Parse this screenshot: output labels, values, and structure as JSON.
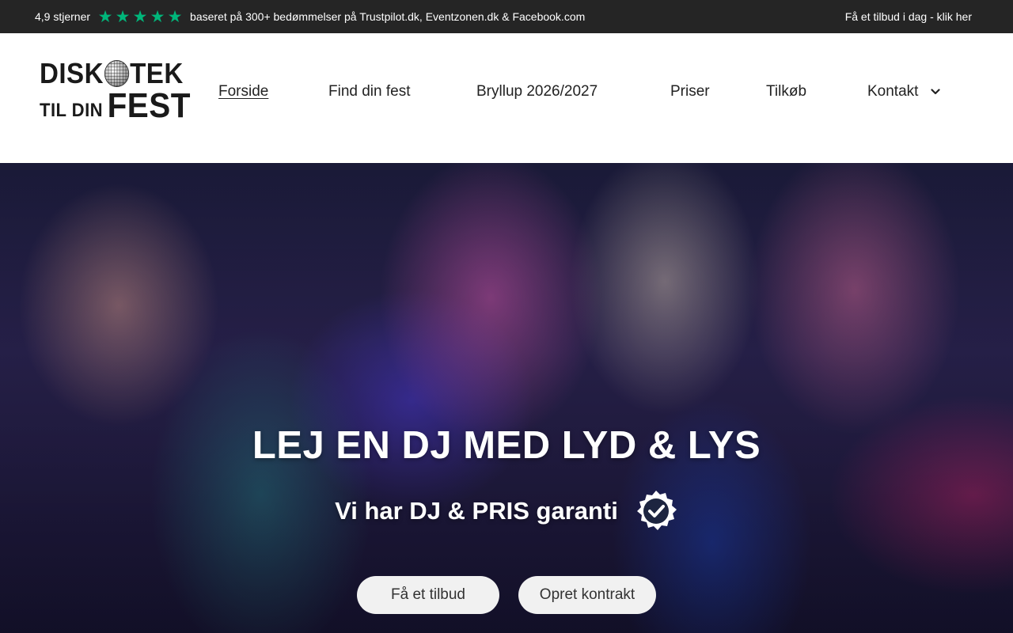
{
  "topbar": {
    "rating_label": "4,9 stjerner",
    "stars": [
      "★",
      "★",
      "★",
      "★",
      "★"
    ],
    "star_color": "#00b67a",
    "reviews_text": "baseret på 300+ bedømmelser på Trustpilot.dk, Eventzonen.dk & Facebook.com",
    "cta_link": "Få et tilbud i dag - klik her"
  },
  "logo": {
    "line1_a": "DISK",
    "line1_b": "TEK",
    "line2_small": "TIL DIN",
    "line2_big": "FEST"
  },
  "nav": {
    "items": [
      {
        "label": "Forside",
        "active": true
      },
      {
        "label": "Find din fest"
      },
      {
        "label": "Bryllup 2026/2027"
      },
      {
        "label": "Priser"
      },
      {
        "label": "Tilkøb"
      },
      {
        "label": "Kontakt",
        "has_dropdown": true
      }
    ]
  },
  "hero": {
    "title": "LEJ EN DJ MED LYD & LYS",
    "subtitle": "Vi har DJ & PRIS garanti",
    "badge_icon": "verified-check-badge-icon",
    "buttons": {
      "primary": "Få et tilbud",
      "secondary": "Opret kontrakt"
    }
  },
  "colors": {
    "topbar_bg": "#252525",
    "header_bg": "#ffffff",
    "button_bg": "#f1f1f1",
    "text_dark": "#222222"
  }
}
